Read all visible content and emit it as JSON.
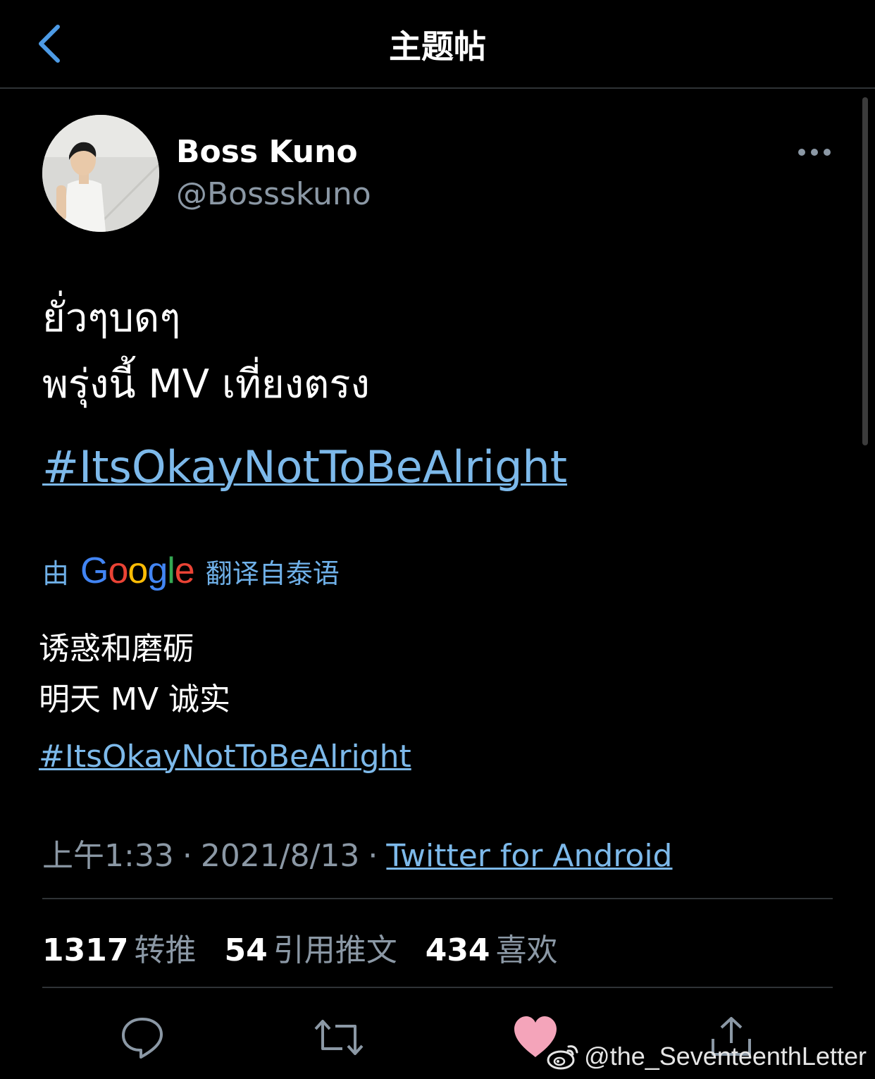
{
  "header": {
    "title": "主题帖"
  },
  "tweet": {
    "display_name": "Boss Kuno",
    "handle": "@Bossskuno",
    "original_lines": [
      "ยั่วๆบดๆ",
      "พรุ่งนี้ MV เที่ยงตรง"
    ],
    "original_hashtag": "#ItsOkayNotToBeAlright",
    "translation_label": {
      "prefix": "由",
      "google": [
        "G",
        "o",
        "o",
        "g",
        "l",
        "e"
      ],
      "suffix": "翻译自泰语"
    },
    "translated_lines": [
      "诱惑和磨砺",
      "明天 MV 诚实"
    ],
    "translated_hashtag": "#ItsOkayNotToBeAlright",
    "time": "上午1:33",
    "date": "2021/8/13",
    "source": "Twitter for Android",
    "separator": "·"
  },
  "stats": [
    {
      "count": "1317",
      "label": "转推"
    },
    {
      "count": "54",
      "label": "引用推文"
    },
    {
      "count": "434",
      "label": "喜欢"
    }
  ],
  "actions": [
    "reply-icon",
    "retweet-icon",
    "like-icon",
    "share-icon"
  ],
  "watermark": "@the_SeventeenthLetter",
  "colors": {
    "accent": "#7db9ea",
    "secondary_text": "#8b98a5",
    "like": "#f4a4ba",
    "divider": "#2f3336",
    "google_blue": "#4285F4",
    "google_red": "#EA4335",
    "google_yellow": "#FBBC05",
    "google_green": "#34A853"
  }
}
